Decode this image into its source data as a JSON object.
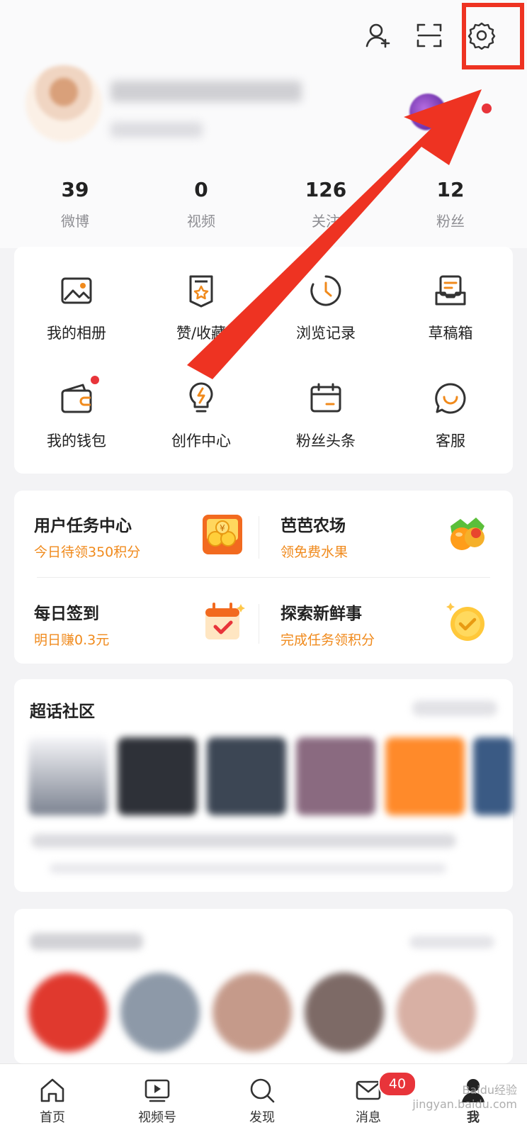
{
  "header": {
    "icons": [
      "add-friend-icon",
      "scan-icon",
      "settings-icon"
    ]
  },
  "profile": {
    "avatar_icon": "avatar",
    "vip_icon": "vip-badge-icon"
  },
  "stats": [
    {
      "num": "39",
      "label": "微博"
    },
    {
      "num": "0",
      "label": "视频"
    },
    {
      "num": "126",
      "label": "关注"
    },
    {
      "num": "12",
      "label": "粉丝"
    }
  ],
  "menu": [
    {
      "label": "我的相册",
      "icon": "photo-album-icon"
    },
    {
      "label": "赞/收藏",
      "icon": "favorites-icon"
    },
    {
      "label": "浏览记录",
      "icon": "history-icon"
    },
    {
      "label": "草稿箱",
      "icon": "drafts-icon"
    },
    {
      "label": "我的钱包",
      "icon": "wallet-icon"
    },
    {
      "label": "创作中心",
      "icon": "creator-center-icon"
    },
    {
      "label": "粉丝头条",
      "icon": "fan-headline-icon"
    },
    {
      "label": "客服",
      "icon": "customer-service-icon"
    }
  ],
  "tasks": [
    {
      "title": "用户任务中心",
      "subtitle": "今日待领350积分"
    },
    {
      "title": "芭芭农场",
      "subtitle": "领免费水果"
    },
    {
      "title": "每日签到",
      "subtitle": "明日赚0.3元"
    },
    {
      "title": "探索新鲜事",
      "subtitle": "完成任务领积分"
    }
  ],
  "supertopic": {
    "title": "超话社区"
  },
  "tabs": [
    {
      "label": "首页",
      "icon": "home-icon"
    },
    {
      "label": "视频号",
      "icon": "video-icon"
    },
    {
      "label": "发现",
      "icon": "search-icon"
    },
    {
      "label": "消息",
      "icon": "message-icon"
    },
    {
      "label": "我",
      "icon": "profile-icon"
    }
  ],
  "message_badge": "40",
  "watermark": "Baidu经验 jingyan.baidu.com",
  "colors": {
    "accent": "#f08a1c",
    "annotation": "#ee3322",
    "badge": "#e8343a"
  }
}
